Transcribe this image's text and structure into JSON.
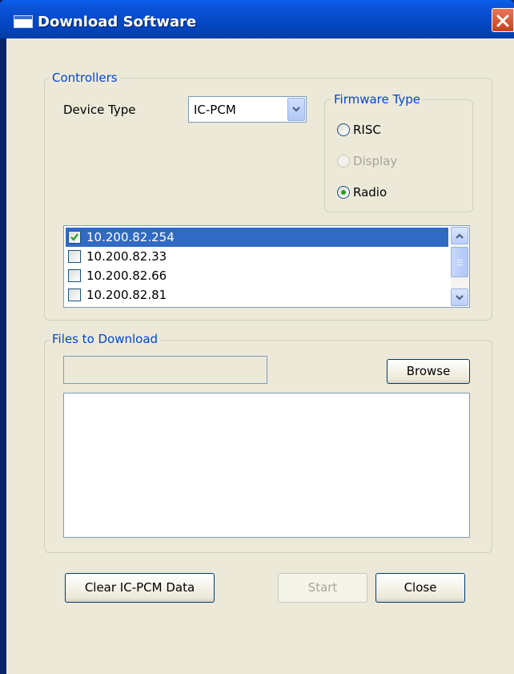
{
  "window": {
    "title": "Download Software"
  },
  "controllers": {
    "group_label": "Controllers",
    "device_type_label": "Device Type",
    "device_type_value": "IC-PCM",
    "firmware": {
      "group_label": "Firmware Type",
      "options": [
        {
          "label": "RISC",
          "selected": false,
          "enabled": true
        },
        {
          "label": "Display",
          "selected": false,
          "enabled": false
        },
        {
          "label": "Radio",
          "selected": true,
          "enabled": true
        }
      ]
    },
    "devices": [
      {
        "ip": "10.200.82.254",
        "checked": true,
        "selected": true
      },
      {
        "ip": "10.200.82.33",
        "checked": false,
        "selected": false
      },
      {
        "ip": "10.200.82.66",
        "checked": false,
        "selected": false
      },
      {
        "ip": "10.200.82.81",
        "checked": false,
        "selected": false
      }
    ]
  },
  "files": {
    "group_label": "Files to Download",
    "path_value": "",
    "browse_label": "Browse"
  },
  "actions": {
    "clear_label": "Clear IC-PCM Data",
    "start_label": "Start",
    "close_label": "Close"
  },
  "colors": {
    "group_label": "#0046d5",
    "selection": "#316ac5",
    "background": "#ece9d8"
  }
}
